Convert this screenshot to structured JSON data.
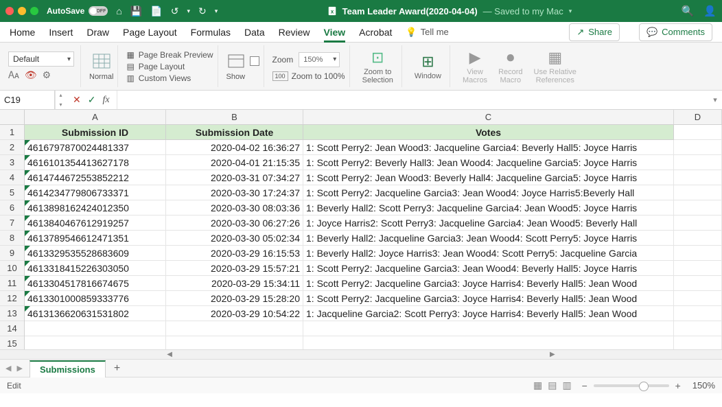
{
  "titlebar": {
    "autosave_label": "AutoSave",
    "autosave_state": "OFF",
    "doc_title": "Team Leader Award(2020-04-04)",
    "doc_saved": "— Saved to my Mac"
  },
  "menu_items": [
    "Home",
    "Insert",
    "Draw",
    "Page Layout",
    "Formulas",
    "Data",
    "Review",
    "View",
    "Acrobat"
  ],
  "active_menu": "View",
  "tell_me": "Tell me",
  "share_btn": "Share",
  "comments_btn": "Comments",
  "ribbon": {
    "font_default": "Default",
    "normal_label": "Normal",
    "pagebreak": "Page Break Preview",
    "pagelayout": "Page Layout",
    "custom": "Custom Views",
    "show_label": "Show",
    "zoom_label": "Zoom",
    "zoom_pct": "150%",
    "zoom_100": "Zoom to 100%",
    "zoom_to_sel": "Zoom to\nSelection",
    "window_label": "Window",
    "view_macros": "View\nMacros",
    "record_macro": "Record\nMacro",
    "use_relative": "Use Relative\nReferences"
  },
  "namebox_value": "C19",
  "col_widths": {
    "A": 206,
    "B": 200,
    "C": 540,
    "D": 70
  },
  "columns": [
    "A",
    "B",
    "C",
    "D"
  ],
  "row_numbers": [
    1,
    2,
    3,
    4,
    5,
    6,
    7,
    8,
    9,
    10,
    11,
    12,
    13,
    14,
    15
  ],
  "headers": {
    "A": "Submission ID",
    "B": "Submission Date",
    "C": "Votes"
  },
  "rows": [
    {
      "a": "4616797870024481337",
      "b": "2020-04-02 16:36:27",
      "c": "1: Scott Perry2: Jean Wood3: Jacqueline Garcia4: Beverly Hall5: Joyce Harris"
    },
    {
      "a": "4616101354413627178",
      "b": "2020-04-01 21:15:35",
      "c": "1: Scott Perry2: Beverly Hall3: Jean Wood4: Jacqueline Garcia5: Joyce Harris"
    },
    {
      "a": "4614744672553852212",
      "b": "2020-03-31 07:34:27",
      "c": "1: Scott Perry2: Jean Wood3: Beverly Hall4: Jacqueline Garcia5: Joyce Harris"
    },
    {
      "a": "4614234779806733371",
      "b": "2020-03-30 17:24:37",
      "c": "1: Scott Perry2: Jacqueline Garcia3: Jean Wood4: Joyce Harris5:Beverly Hall"
    },
    {
      "a": "4613898162424012350",
      "b": "2020-03-30 08:03:36",
      "c": "1: Beverly Hall2: Scott Perry3: Jacqueline Garcia4: Jean Wood5: Joyce Harris"
    },
    {
      "a": "4613840467612919257",
      "b": "2020-03-30 06:27:26",
      "c": "1: Joyce Harris2: Scott Perry3: Jacqueline Garcia4: Jean Wood5: Beverly Hall"
    },
    {
      "a": "4613789546612471351",
      "b": "2020-03-30 05:02:34",
      "c": "1: Beverly Hall2: Jacqueline Garcia3: Jean Wood4: Scott Perry5: Joyce Harris"
    },
    {
      "a": "4613329535528683609",
      "b": "2020-03-29 16:15:53",
      "c": "1: Beverly Hall2: Joyce Harris3: Jean Wood4: Scott Perry5: Jacqueline Garcia"
    },
    {
      "a": "4613318415226303050",
      "b": "2020-03-29 15:57:21",
      "c": "1: Scott Perry2: Jacqueline Garcia3: Jean Wood4: Beverly Hall5: Joyce Harris"
    },
    {
      "a": "4613304517816674675",
      "b": "2020-03-29 15:34:11",
      "c": "1: Scott Perry2: Jacqueline Garcia3: Joyce Harris4: Beverly Hall5: Jean Wood"
    },
    {
      "a": "4613301000859333776",
      "b": "2020-03-29 15:28:20",
      "c": "1: Scott Perry2: Jacqueline Garcia3: Joyce Harris4: Beverly Hall5: Jean Wood"
    },
    {
      "a": "4613136620631531802",
      "b": "2020-03-29 10:54:22",
      "c": "1: Jacqueline Garcia2: Scott Perry3: Joyce Harris4: Beverly Hall5: Jean Wood"
    }
  ],
  "tabs": {
    "active": "Submissions"
  },
  "status": {
    "mode": "Edit",
    "zoom": "150%"
  }
}
